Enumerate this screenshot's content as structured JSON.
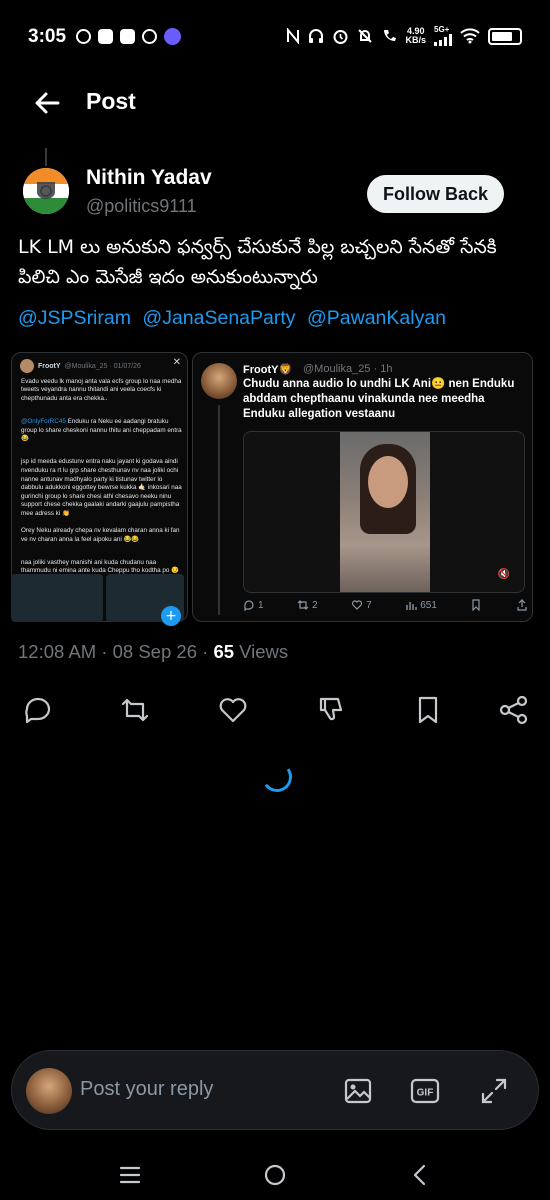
{
  "status_bar": {
    "time": "3:05",
    "net_speed_value": "4.90",
    "net_speed_unit": "KB/s",
    "network_type": "5G+"
  },
  "header": {
    "title": "Post",
    "back_icon": "arrow-left-icon"
  },
  "post": {
    "author_name": "Nithin Yadav",
    "author_handle": "@politics9111",
    "follow_label": "Follow Back",
    "text": "LK LM లు అనుకుని ఫన్వర్స్ చేసుకునే పిల్ల బచ్చలని సేనతో సేనకి పిలిచి ఎం మెసేజీ ఇదం అనుకుంటున్నారు",
    "mentions": [
      "@JSPSriram",
      "@JanaSenaParty",
      "@PawanKalyan"
    ],
    "time": "12:08 AM",
    "date": "08 Sep 26",
    "views_count": "65",
    "views_label": "Views"
  },
  "media_left": {
    "name": "FrootY",
    "handle_date": "@Moulika_25 · 01/07/26",
    "close_icon": "close-icon",
    "line1": "Evadu veedu lk manoj anta vala ecfs group lo naa medha tweets veyandra nannu thitandi ani veela coecfs ki chepthunadu anta era chekka..",
    "line2_mention": "@OnlyForRC45",
    "line2": " Enduku ra Neku ee aadangi bratuku group lo share cheskoni nannu thitu ani cheppadam entra 😂",
    "line3": "jsp id meeda edustunv entra naku jayant ki godava aindi nvenduku ra rt lu grp share chesthunav nv naa joliki ochi nanne antunav madhyalo party ki tistunav twitter lo dabbulu adukkoni eggottey bewrse kukka 🤙🏻 inkosari naa gurinchi group lo share chesi athi chesavo neeku ninu support chese chekka gaalaki andarki gaajulu pampistha mee adress ki 👏",
    "line4": "Orey Neku already chepa nv kevalam charan anna ki fan ve nv charan anna la feel aipoku ani 😂😂",
    "line5": "naa joliki vasthey manishi ani kuda chudanu naa thammudu ni emina ante kuda Cheppu tho kodtha po 😏",
    "fab_icon": "plus-icon"
  },
  "media_right": {
    "name": "FrootY🦁",
    "handle_time": "@Moulika_25 · 1h",
    "text": "Chudu anna audio lo undhi LK Ani😐 nen Enduku abddam chepthaanu vinakunda nee meedha Enduku allegation vestaanu",
    "mute_icon": "mute-icon",
    "replies": "1",
    "reposts": "2",
    "likes": "7",
    "views": "651"
  },
  "actions": [
    "reply-icon",
    "repost-icon",
    "like-icon",
    "dislike-icon",
    "bookmark-icon",
    "share-icon"
  ],
  "reply_bar": {
    "placeholder": "Post your reply",
    "icons": [
      "image-icon",
      "gif-icon",
      "expand-icon"
    ]
  },
  "colors": {
    "background": "#000000",
    "link": "#1d9bf0",
    "secondary_text": "#71767b",
    "follow_bg": "#eff3f4"
  }
}
